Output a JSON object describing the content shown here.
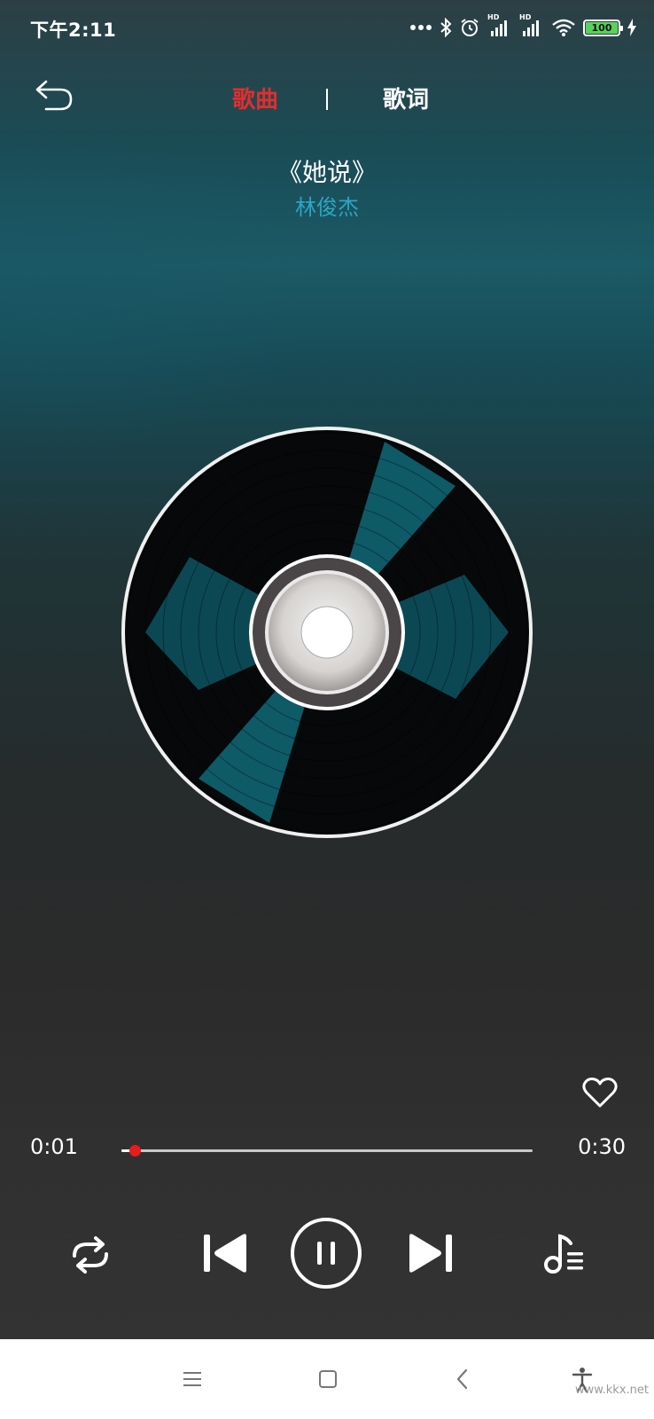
{
  "status_bar": {
    "time": "下午2:11",
    "battery": "100",
    "signal_labels": [
      "HD",
      "HD"
    ]
  },
  "header": {
    "tabs": [
      {
        "label": "歌曲",
        "active": true
      },
      {
        "label": "歌词",
        "active": false
      }
    ]
  },
  "song": {
    "title": "《她说》",
    "artist": "林俊杰"
  },
  "player": {
    "current_time": "0:01",
    "total_time": "0:30",
    "progress_fraction": 0.033,
    "state": "playing"
  },
  "icons": {
    "back": "undo-back-arrow-icon",
    "favorite": "heart-outline-icon",
    "repeat": "repeat-icon",
    "previous": "skip-previous-icon",
    "pause": "pause-circle-icon",
    "next": "skip-next-icon",
    "playlist": "playlist-music-icon"
  },
  "colors": {
    "active_tab": "#e02e2e",
    "artist": "#2aa6c4",
    "progress_thumb": "#e81c1c",
    "battery_fill": "#58d25a"
  },
  "watermark": "www.kkx.net"
}
